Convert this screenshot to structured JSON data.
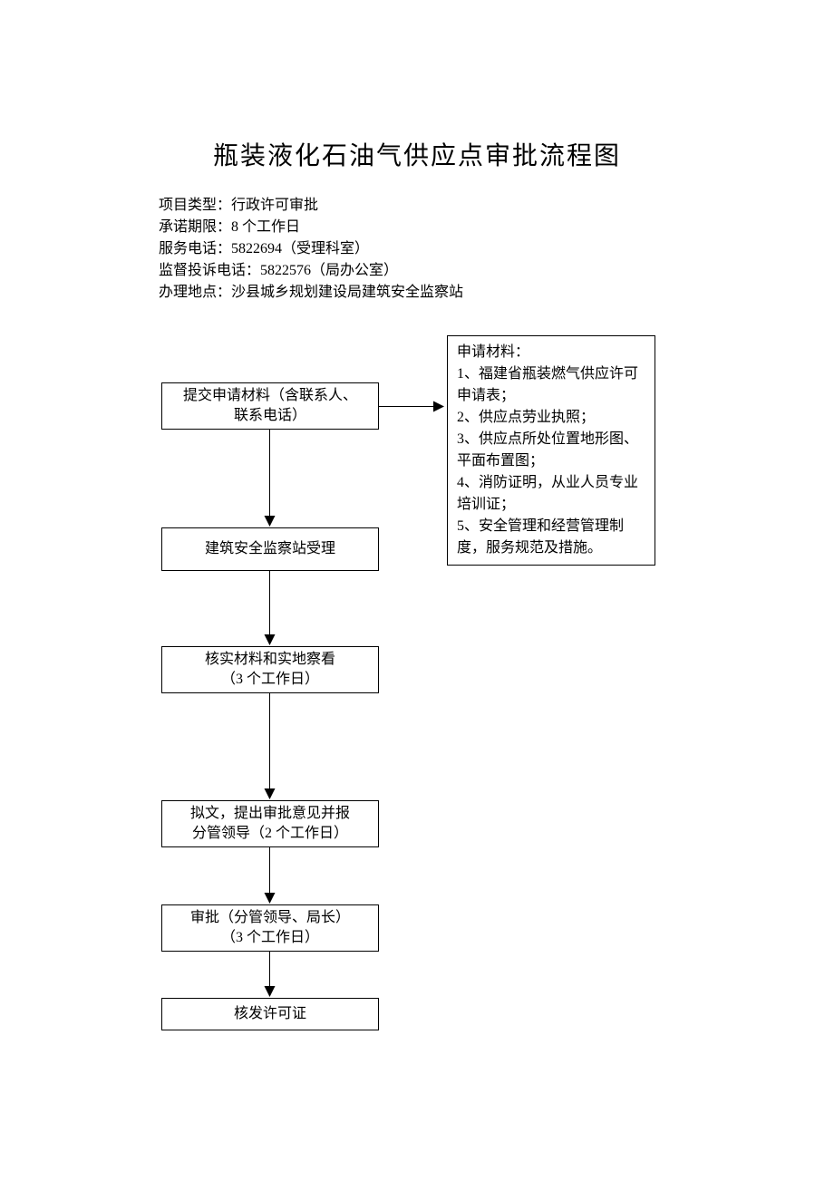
{
  "title": "瓶装液化石油气供应点审批流程图",
  "info": {
    "line1": "项目类型：行政许可审批",
    "line2": "承诺期限：8 个工作日",
    "line3": "服务电话：5822694（受理科室）",
    "line4": "监督投诉电话：5822576（局办公室）",
    "line5": "办理地点：沙县城乡规划建设局建筑安全监察站"
  },
  "steps": {
    "s1_l1": "提交申请材料（含联系人、",
    "s1_l2": "联系电话）",
    "s2": "建筑安全监察站受理",
    "s3_l1": "核实材料和实地察看",
    "s3_l2": "（3 个工作日）",
    "s4_l1": "拟文，提出审批意见并报",
    "s4_l2": "分管领导（2 个工作日）",
    "s5_l1": "审批（分管领导、局长）",
    "s5_l2": "（3 个工作日）",
    "s6": "核发许可证"
  },
  "materials": {
    "title": "申请材料：",
    "m1": "1、福建省瓶装燃气供应许可申请表；",
    "m2": "2、供应点劳业执照；",
    "m3": "3、供应点所处位置地形图、平面布置图；",
    "m4": "4、消防证明，从业人员专业培训证；",
    "m5": "5、安全管理和经营管理制度，服务规范及措施。"
  }
}
